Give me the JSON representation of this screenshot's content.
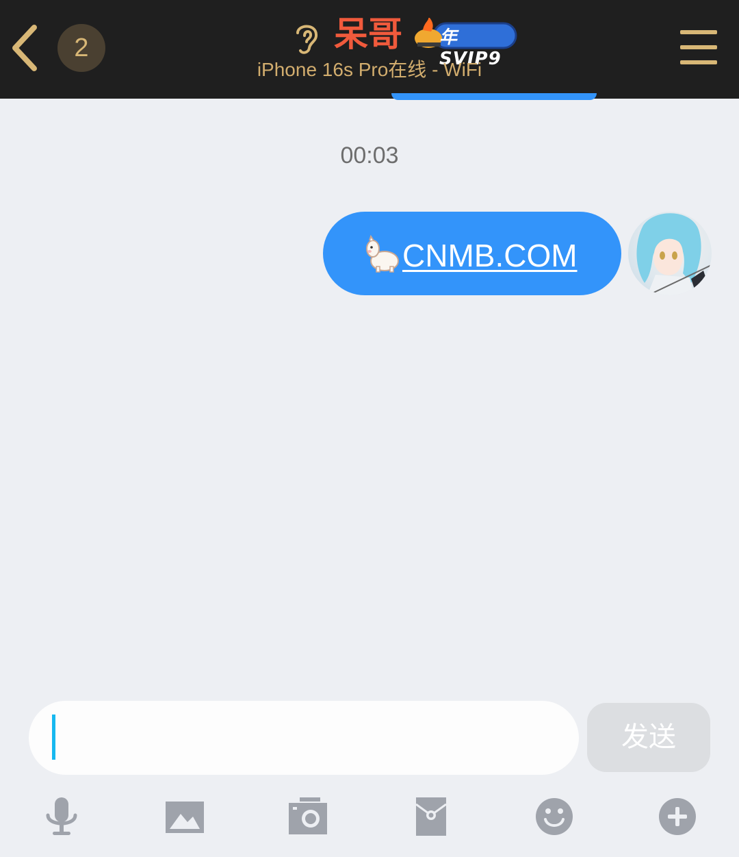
{
  "header": {
    "back_icon": "chevron-left-icon",
    "unread_count": "2",
    "contact_name": "呆哥",
    "vip_badge_text": "年SVIP9",
    "online_status": "iPhone 16s Pro在线 - WiFi",
    "menu_icon": "hamburger-menu-icon",
    "accent_color": "#d8b776",
    "name_color": "#f05a3c"
  },
  "chat": {
    "messages": [
      {
        "time": "00:03",
        "emoji_icon": "alpaca-icon",
        "link_text": "CNMB.COM",
        "bubble_color": "#3394fa"
      }
    ]
  },
  "composer": {
    "input_value": "",
    "send_label": "发送"
  },
  "toolbar": {
    "items": [
      "microphone-icon",
      "image-icon",
      "camera-icon",
      "red-packet-icon",
      "emoji-icon",
      "plus-icon"
    ]
  }
}
